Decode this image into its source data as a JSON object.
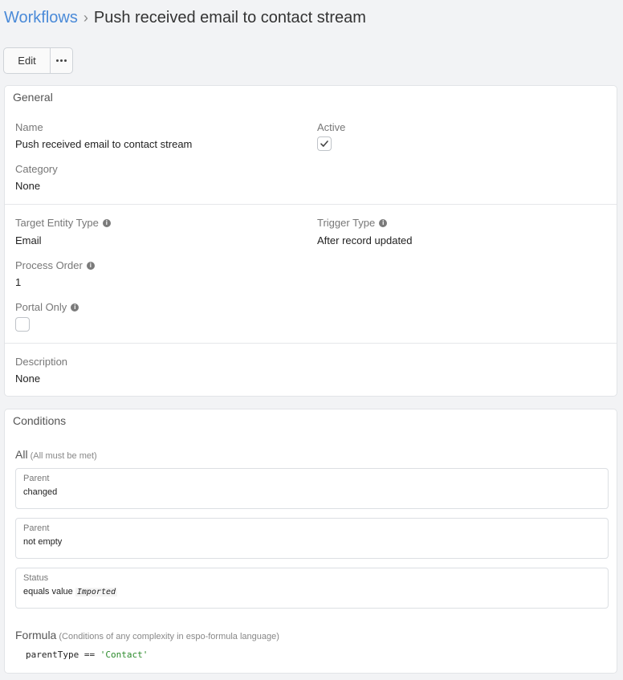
{
  "breadcrumb": {
    "parent": "Workflows",
    "separator": "›",
    "current": "Push received email to contact stream"
  },
  "toolbar": {
    "edit_label": "Edit",
    "more_icon": "ellipsis-icon"
  },
  "general": {
    "title": "General",
    "name_label": "Name",
    "name_value": "Push received email to contact stream",
    "active_label": "Active",
    "active_checked": true,
    "category_label": "Category",
    "category_value": "None",
    "target_entity_label": "Target Entity Type",
    "target_entity_value": "Email",
    "trigger_type_label": "Trigger Type",
    "trigger_type_value": "After record updated",
    "process_order_label": "Process Order",
    "process_order_value": "1",
    "portal_only_label": "Portal Only",
    "portal_only_checked": false,
    "description_label": "Description",
    "description_value": "None",
    "info_icon_glyph": "i"
  },
  "conditions": {
    "title": "Conditions",
    "all_label": "All",
    "all_sub": "(All must be met)",
    "items": [
      {
        "field": "Parent",
        "desc": "changed",
        "value": ""
      },
      {
        "field": "Parent",
        "desc": "not empty",
        "value": ""
      },
      {
        "field": "Status",
        "desc": "equals value",
        "value": "Imported"
      }
    ],
    "formula_label": "Formula",
    "formula_sub": "(Conditions of any complexity in espo-formula language)",
    "formula_code_plain": "parentType == ",
    "formula_code_string": "'Contact'"
  },
  "colors": {
    "link": "#4a8ad8",
    "string_literal": "#2a8a2a"
  }
}
